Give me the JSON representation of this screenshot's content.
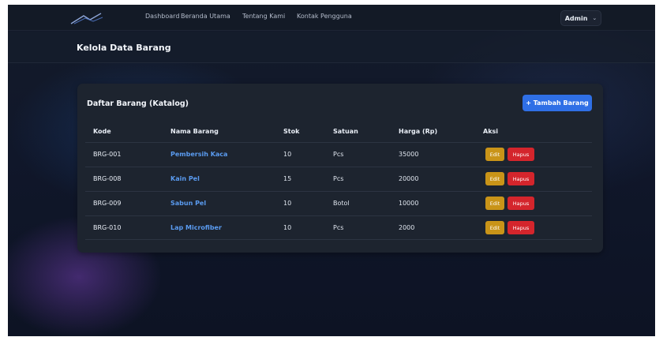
{
  "navbar": {
    "logo_icon": "mountain-logo-icon",
    "links": [
      "Dashboard",
      "Beranda Utama",
      "Tentang Kami",
      "Kontak Pengguna"
    ],
    "user": {
      "label": "Admin",
      "caret": "⌄"
    }
  },
  "header": {
    "title": "Kelola Data Barang"
  },
  "card": {
    "title": "Daftar Barang (Katalog)",
    "add_button": "+ Tambah Barang",
    "columns": [
      "Kode",
      "Nama Barang",
      "Stok",
      "Satuan",
      "Harga (Rp)",
      "Aksi"
    ],
    "rows": [
      {
        "kode": "BRG-001",
        "nama": "Pembersih Kaca",
        "stok": "10",
        "satuan": "Pcs",
        "harga": "35000"
      },
      {
        "kode": "BRG-008",
        "nama": "Kain Pel",
        "stok": "15",
        "satuan": "Pcs",
        "harga": "20000"
      },
      {
        "kode": "BRG-009",
        "nama": "Sabun Pel",
        "stok": "10",
        "satuan": "Botol",
        "harga": "10000"
      },
      {
        "kode": "BRG-010",
        "nama": "Lap Microfiber",
        "stok": "10",
        "satuan": "Pcs",
        "harga": "2000"
      }
    ],
    "actions": {
      "edit": "Edit",
      "delete": "Hapus"
    }
  },
  "colors": {
    "accent": "#2f6fe6",
    "edit": "#c99418",
    "delete": "#d4252c",
    "link": "#5a9bf0"
  }
}
